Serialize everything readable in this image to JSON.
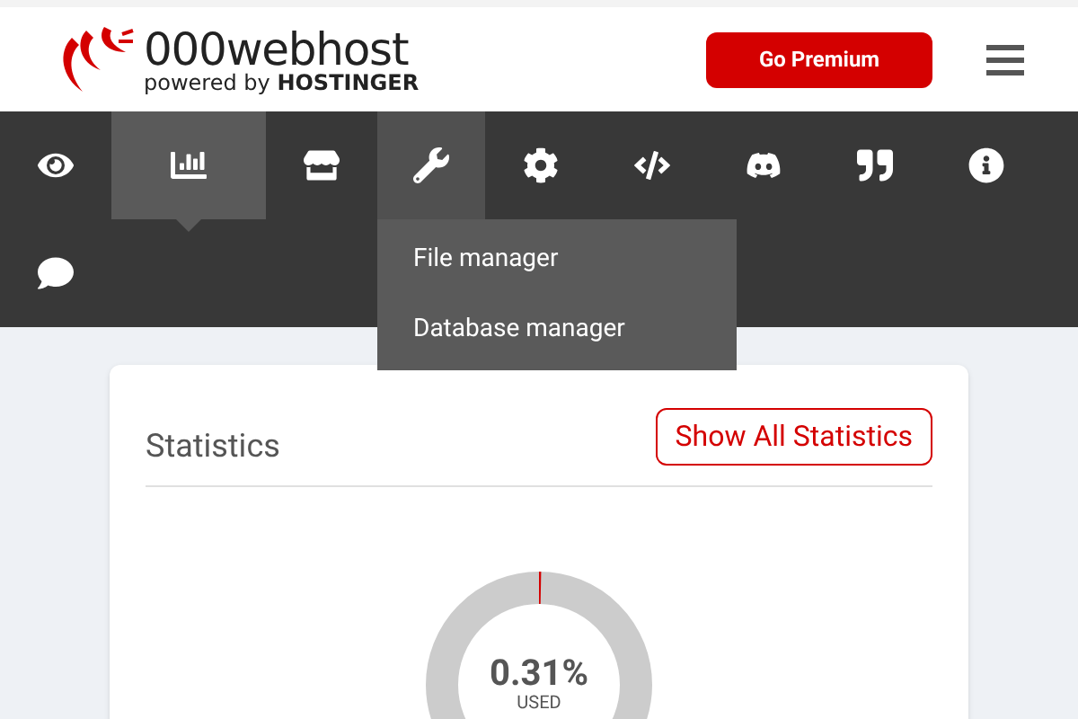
{
  "header": {
    "logo": {
      "name": "000webhost",
      "tagline": "powered by **HOSTINGER**"
    },
    "premium_button": "Go Premium"
  },
  "nav": {
    "items": [
      {
        "selected": false,
        "expanded": false
      },
      {
        "selected": true,
        "expanded": false
      },
      {
        "selected": false,
        "expanded": false
      },
      {
        "selected": false,
        "expanded": true,
        "menu": [
          "File manager",
          "Database manager"
        ]
      },
      {
        "selected": false,
        "expanded": false
      },
      {
        "selected": false,
        "expanded": false
      },
      {
        "selected": false,
        "expanded": false
      },
      {
        "selected": false,
        "expanded": false
      },
      {
        "selected": false,
        "expanded": false
      },
      {
        "selected": false,
        "expanded": false
      }
    ]
  },
  "statistics": {
    "title": "Statistics",
    "button": "Show All Statistics",
    "gauge": {
      "level": 0.0031,
      "reading": "0.31%",
      "label": "USED"
    }
  }
}
